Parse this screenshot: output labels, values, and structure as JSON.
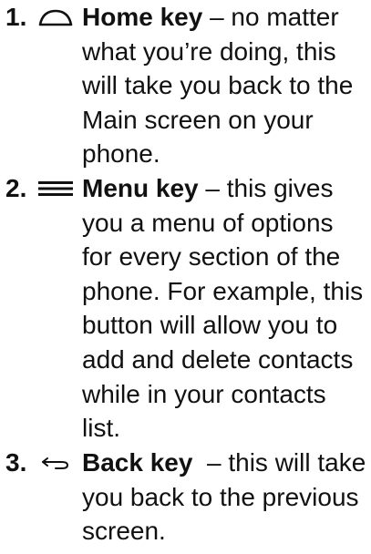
{
  "items": [
    {
      "number": "1.",
      "icon": "home-outline-icon",
      "term": "Home key",
      "lines": [
        " – no matter",
        "what you’re doing, this",
        "will take you back to the",
        "Main screen on your",
        "phone."
      ]
    },
    {
      "number": "2.",
      "icon": "menu-bars-icon",
      "term": "Menu key",
      "lines": [
        " – this gives",
        "you a menu of options",
        "for every section of the",
        "phone. For example, this",
        "button will allow you to",
        "add and delete contacts",
        "while in your contacts",
        "list."
      ]
    },
    {
      "number": "3.",
      "icon": "back-arrow-icon",
      "term": "Back key",
      "lines": [
        "  – this will take",
        "you back to the previous",
        "screen."
      ]
    }
  ]
}
